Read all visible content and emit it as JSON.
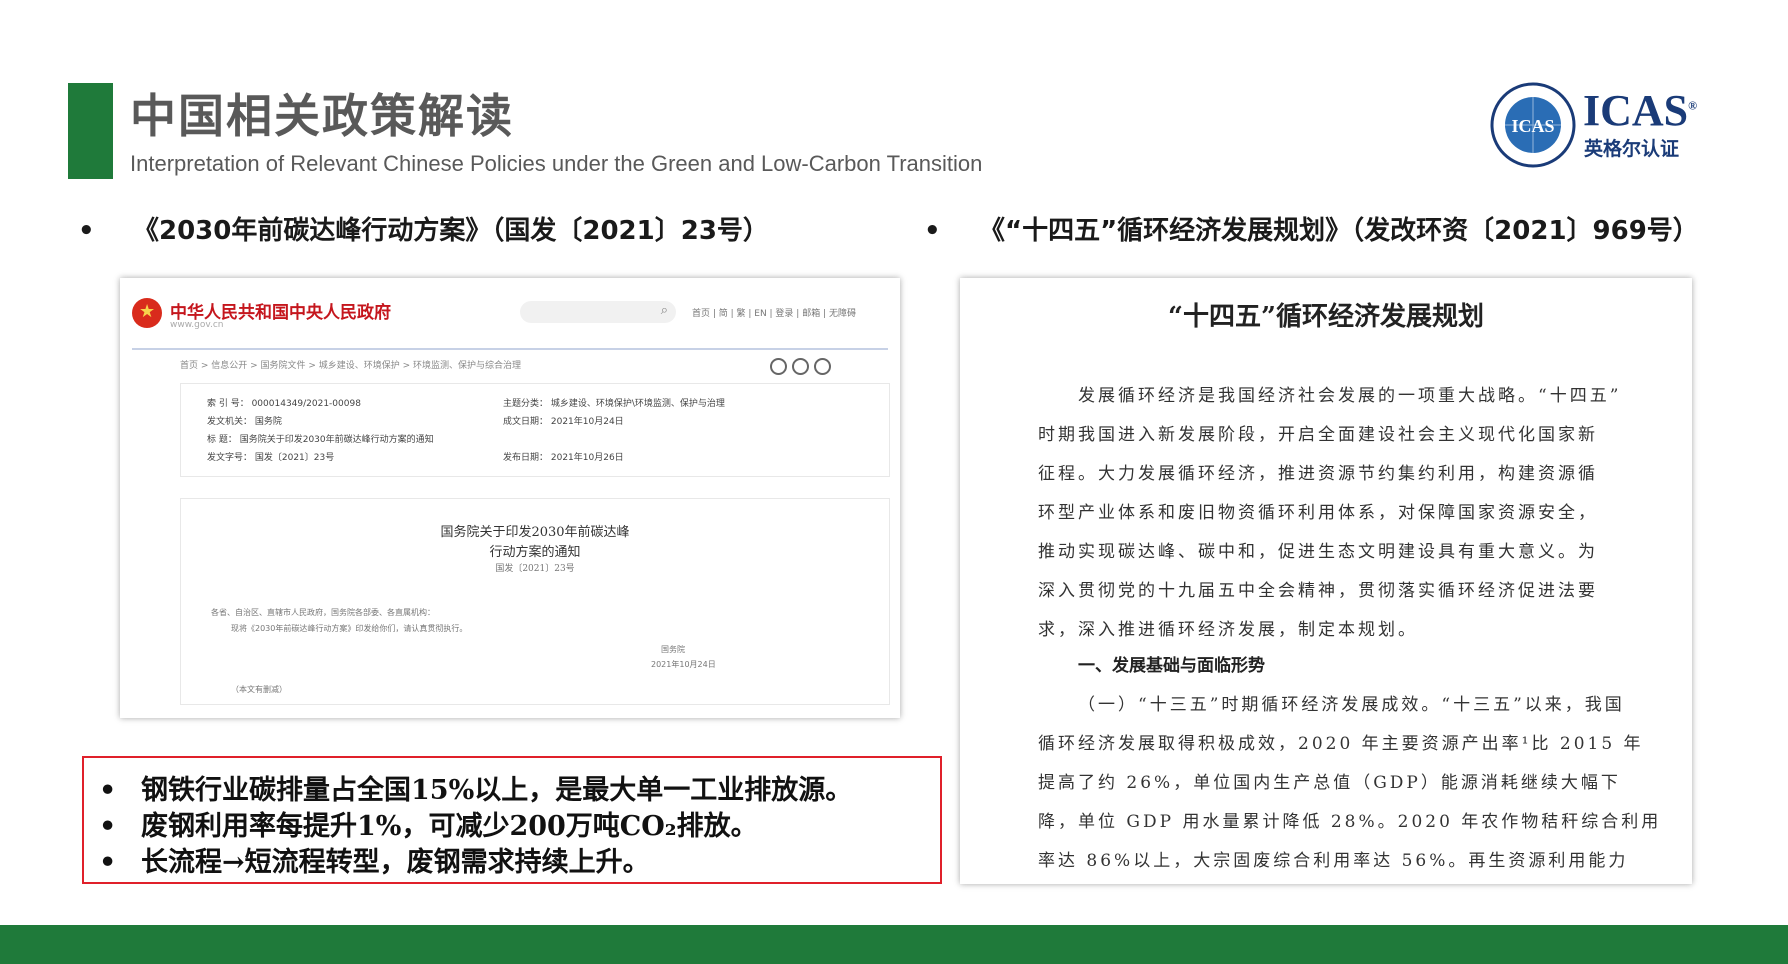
{
  "header": {
    "title_cn": "中国相关政策解读",
    "title_en": "Interpretation of Relevant Chinese Policies under the Green and Low-Carbon Transition"
  },
  "logo": {
    "text": "ICAS",
    "sub": "英格尔认证",
    "reg": "®",
    "badge": "ICAS"
  },
  "left_section": {
    "bullet": "•",
    "title": "《2030年前碳达峰行动方案》（国发〔2021〕23号）"
  },
  "right_section": {
    "bullet": "•",
    "title": "《“十四五”循环经济发展规划》（发改环资〔2021〕969号）"
  },
  "gov_page": {
    "site_name": "中华人民共和国中央人民政府",
    "site_url": "www.gov.cn",
    "nav_links": "首页 | 简 | 繁 | EN | 登录 | 邮箱 | 无障碍",
    "breadcrumb": "首页 > 信息公开 > 国务院文件 > 城乡建设、环境保护 > 环境监测、保护与综合治理",
    "meta": {
      "index_no": "索 引 号：  000014349/2021-00098",
      "issuer": "发文机关：  国务院",
      "subject": "标      题：  国务院关于印发2030年前碳达峰行动方案的通知",
      "doc_no": "发文字号：  国发〔2021〕23号",
      "category": "主题分类：  城乡建设、环境保护\\环境监测、保护与治理",
      "date_written": "成文日期：  2021年10月24日",
      "date_published": "发布日期：  2021年10月26日"
    },
    "notice_title_1": "国务院关于印发2030年前碳达峰",
    "notice_title_2": "行动方案的通知",
    "notice_no": "国发〔2021〕23号",
    "body_1": "各省、自治区、直辖市人民政府，国务院各部委、各直属机构：",
    "body_2": "现将《2030年前碳达峰行动方案》印发给你们，请认真贯彻执行。",
    "signature": "国务院",
    "sign_date": "2021年10月24日",
    "footnote": "（本文有删减）"
  },
  "plan_doc": {
    "title": "“十四五”循环经济发展规划",
    "lines": [
      "发展循环经济是我国经济社会发展的一项重大战略。“十四五”",
      "时期我国进入新发展阶段，开启全面建设社会主义现代化国家新",
      "征程。大力发展循环经济，推进资源节约集约利用，构建资源循",
      "环型产业体系和废旧物资循环利用体系，对保障国家资源安全，",
      "推动实现碳达峰、碳中和，促进生态文明建设具有重大意义。为",
      "深入贯彻党的十九届五中全会精神，贯彻落实循环经济促进法要",
      "求，深入推进循环经济发展，制定本规划。"
    ],
    "heading": "一、发展基础与面临形势",
    "lines2": [
      "（一）“十三五”时期循环经济发展成效。“十三五”以来，我国",
      "循环经济发展取得积极成效，2020 年主要资源产出率¹比 2015 年",
      "提高了约 26%，单位国内生产总值（GDP）能源消耗继续大幅下",
      "降，单位 GDP 用水量累计降低 28%。2020 年农作物秸秆综合利用",
      "率达 86%以上，大宗固废综合利用率达 56%。再生资源利用能力"
    ]
  },
  "highlights": {
    "bullet": "•",
    "items": [
      "钢铁行业碳排量占全国15%以上，是最大单一工业排放源。",
      "废钢利用率每提升1%，可减少200万吨CO₂排放。",
      "长流程→短流程转型，废钢需求持续上升。"
    ]
  },
  "colors": {
    "brand_green": "#1f7a3a",
    "highlight_red": "#e0202a",
    "logo_blue": "#1a3b78",
    "gov_red": "#c5161d"
  }
}
